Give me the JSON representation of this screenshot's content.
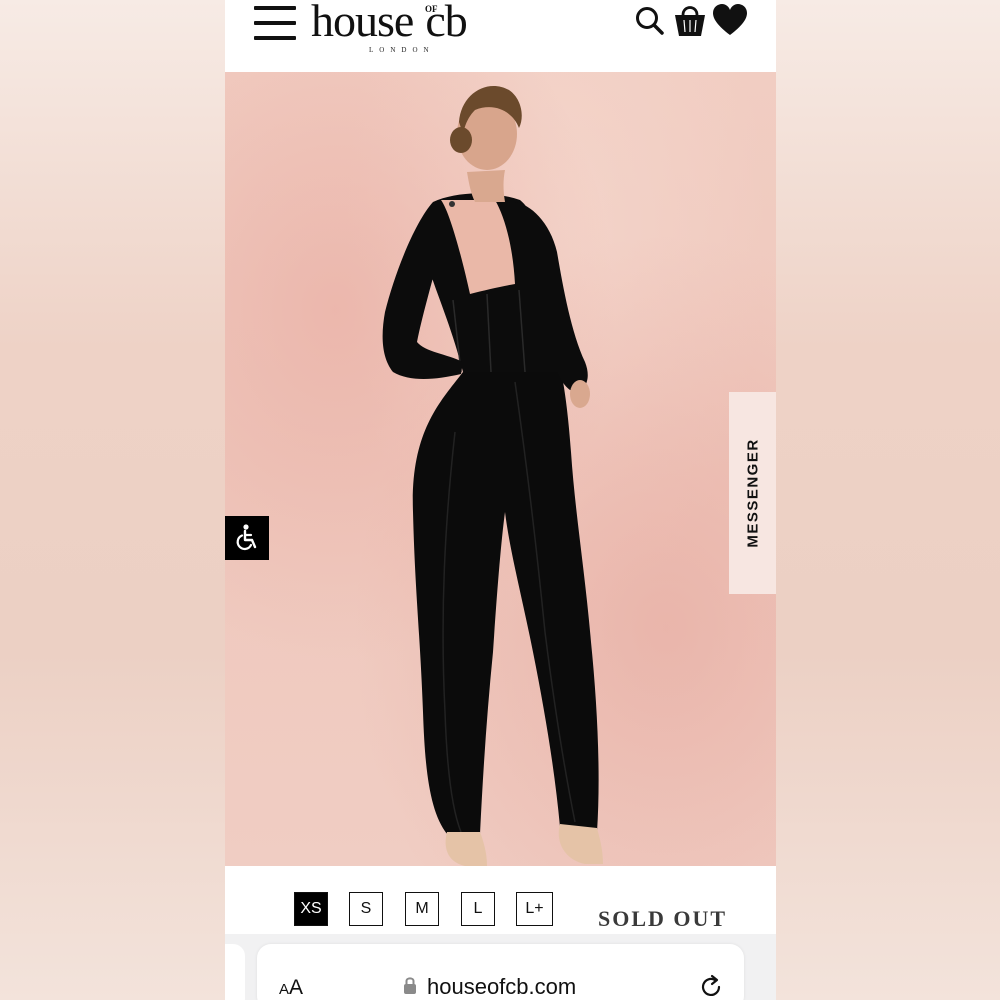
{
  "brand": {
    "name": "house",
    "name_tail": "cb",
    "of_mark": "OF",
    "location": "LONDON"
  },
  "header_icons": [
    "menu-icon",
    "search-icon",
    "shopping-bag-icon",
    "heart-icon"
  ],
  "hero": {
    "accessibility_icon": "wheelchair-icon",
    "messenger_label": "MESSENGER"
  },
  "sizes": {
    "options": [
      "XS",
      "S",
      "M",
      "L",
      "L+"
    ],
    "selected": "XS",
    "status": "SOLD OUT"
  },
  "browser": {
    "text_size_small": "A",
    "text_size_large": "A",
    "url": "houseofcb.com",
    "lock_icon": "lock-icon",
    "reload_icon": "reload-icon"
  },
  "colors": {
    "brand_black": "#111111",
    "hero_background": "#f0cbc0",
    "messenger_background": "#f7e6e1",
    "browser_bar": "#f1f1f2"
  }
}
